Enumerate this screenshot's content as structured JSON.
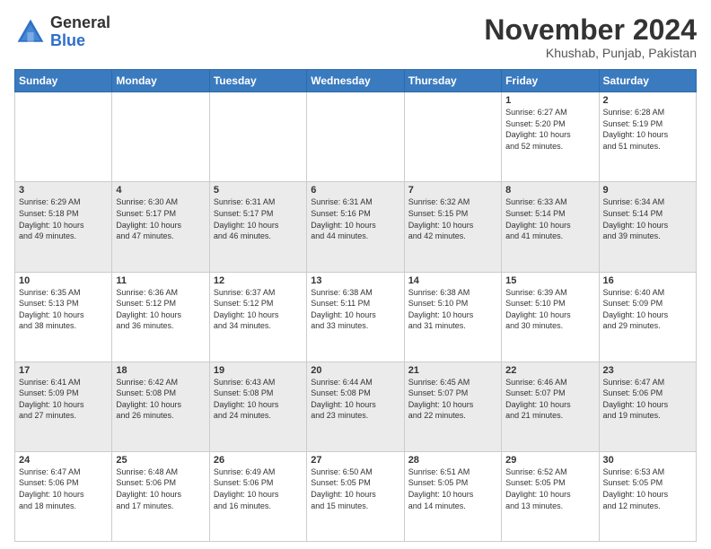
{
  "header": {
    "logo_general": "General",
    "logo_blue": "Blue",
    "month": "November 2024",
    "location": "Khushab, Punjab, Pakistan"
  },
  "days_of_week": [
    "Sunday",
    "Monday",
    "Tuesday",
    "Wednesday",
    "Thursday",
    "Friday",
    "Saturday"
  ],
  "weeks": [
    [
      {
        "day": "",
        "info": ""
      },
      {
        "day": "",
        "info": ""
      },
      {
        "day": "",
        "info": ""
      },
      {
        "day": "",
        "info": ""
      },
      {
        "day": "",
        "info": ""
      },
      {
        "day": "1",
        "info": "Sunrise: 6:27 AM\nSunset: 5:20 PM\nDaylight: 10 hours\nand 52 minutes."
      },
      {
        "day": "2",
        "info": "Sunrise: 6:28 AM\nSunset: 5:19 PM\nDaylight: 10 hours\nand 51 minutes."
      }
    ],
    [
      {
        "day": "3",
        "info": "Sunrise: 6:29 AM\nSunset: 5:18 PM\nDaylight: 10 hours\nand 49 minutes."
      },
      {
        "day": "4",
        "info": "Sunrise: 6:30 AM\nSunset: 5:17 PM\nDaylight: 10 hours\nand 47 minutes."
      },
      {
        "day": "5",
        "info": "Sunrise: 6:31 AM\nSunset: 5:17 PM\nDaylight: 10 hours\nand 46 minutes."
      },
      {
        "day": "6",
        "info": "Sunrise: 6:31 AM\nSunset: 5:16 PM\nDaylight: 10 hours\nand 44 minutes."
      },
      {
        "day": "7",
        "info": "Sunrise: 6:32 AM\nSunset: 5:15 PM\nDaylight: 10 hours\nand 42 minutes."
      },
      {
        "day": "8",
        "info": "Sunrise: 6:33 AM\nSunset: 5:14 PM\nDaylight: 10 hours\nand 41 minutes."
      },
      {
        "day": "9",
        "info": "Sunrise: 6:34 AM\nSunset: 5:14 PM\nDaylight: 10 hours\nand 39 minutes."
      }
    ],
    [
      {
        "day": "10",
        "info": "Sunrise: 6:35 AM\nSunset: 5:13 PM\nDaylight: 10 hours\nand 38 minutes."
      },
      {
        "day": "11",
        "info": "Sunrise: 6:36 AM\nSunset: 5:12 PM\nDaylight: 10 hours\nand 36 minutes."
      },
      {
        "day": "12",
        "info": "Sunrise: 6:37 AM\nSunset: 5:12 PM\nDaylight: 10 hours\nand 34 minutes."
      },
      {
        "day": "13",
        "info": "Sunrise: 6:38 AM\nSunset: 5:11 PM\nDaylight: 10 hours\nand 33 minutes."
      },
      {
        "day": "14",
        "info": "Sunrise: 6:38 AM\nSunset: 5:10 PM\nDaylight: 10 hours\nand 31 minutes."
      },
      {
        "day": "15",
        "info": "Sunrise: 6:39 AM\nSunset: 5:10 PM\nDaylight: 10 hours\nand 30 minutes."
      },
      {
        "day": "16",
        "info": "Sunrise: 6:40 AM\nSunset: 5:09 PM\nDaylight: 10 hours\nand 29 minutes."
      }
    ],
    [
      {
        "day": "17",
        "info": "Sunrise: 6:41 AM\nSunset: 5:09 PM\nDaylight: 10 hours\nand 27 minutes."
      },
      {
        "day": "18",
        "info": "Sunrise: 6:42 AM\nSunset: 5:08 PM\nDaylight: 10 hours\nand 26 minutes."
      },
      {
        "day": "19",
        "info": "Sunrise: 6:43 AM\nSunset: 5:08 PM\nDaylight: 10 hours\nand 24 minutes."
      },
      {
        "day": "20",
        "info": "Sunrise: 6:44 AM\nSunset: 5:08 PM\nDaylight: 10 hours\nand 23 minutes."
      },
      {
        "day": "21",
        "info": "Sunrise: 6:45 AM\nSunset: 5:07 PM\nDaylight: 10 hours\nand 22 minutes."
      },
      {
        "day": "22",
        "info": "Sunrise: 6:46 AM\nSunset: 5:07 PM\nDaylight: 10 hours\nand 21 minutes."
      },
      {
        "day": "23",
        "info": "Sunrise: 6:47 AM\nSunset: 5:06 PM\nDaylight: 10 hours\nand 19 minutes."
      }
    ],
    [
      {
        "day": "24",
        "info": "Sunrise: 6:47 AM\nSunset: 5:06 PM\nDaylight: 10 hours\nand 18 minutes."
      },
      {
        "day": "25",
        "info": "Sunrise: 6:48 AM\nSunset: 5:06 PM\nDaylight: 10 hours\nand 17 minutes."
      },
      {
        "day": "26",
        "info": "Sunrise: 6:49 AM\nSunset: 5:06 PM\nDaylight: 10 hours\nand 16 minutes."
      },
      {
        "day": "27",
        "info": "Sunrise: 6:50 AM\nSunset: 5:05 PM\nDaylight: 10 hours\nand 15 minutes."
      },
      {
        "day": "28",
        "info": "Sunrise: 6:51 AM\nSunset: 5:05 PM\nDaylight: 10 hours\nand 14 minutes."
      },
      {
        "day": "29",
        "info": "Sunrise: 6:52 AM\nSunset: 5:05 PM\nDaylight: 10 hours\nand 13 minutes."
      },
      {
        "day": "30",
        "info": "Sunrise: 6:53 AM\nSunset: 5:05 PM\nDaylight: 10 hours\nand 12 minutes."
      }
    ]
  ]
}
